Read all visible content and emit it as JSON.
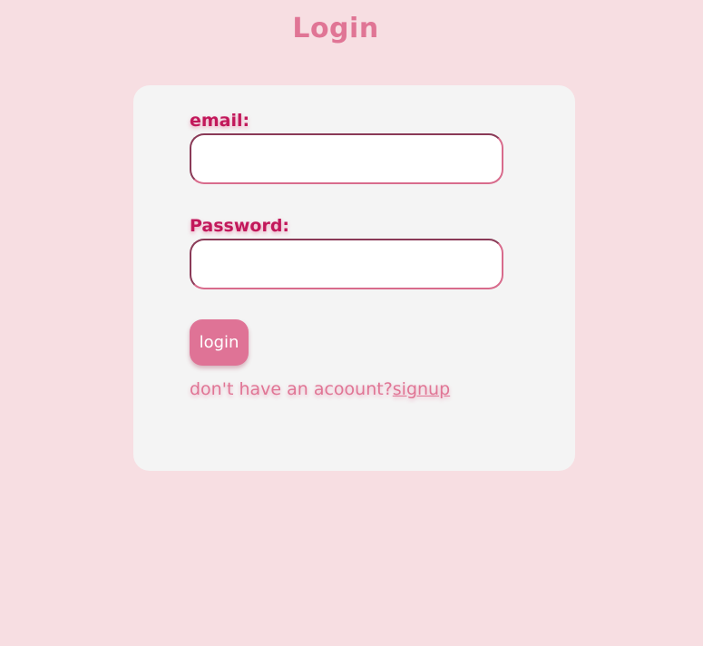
{
  "page": {
    "title": "Login"
  },
  "form": {
    "email_label": "email:",
    "email_value": "",
    "email_placeholder": "",
    "password_label": "Password:",
    "password_value": "",
    "password_placeholder": "",
    "login_button": "login",
    "signup_prompt": "don't have an acoount?",
    "signup_link": "signup"
  },
  "colors": {
    "background": "#f7dee2",
    "card": "#f4f4f4",
    "accent": "#df7396",
    "label": "#c2185b"
  }
}
